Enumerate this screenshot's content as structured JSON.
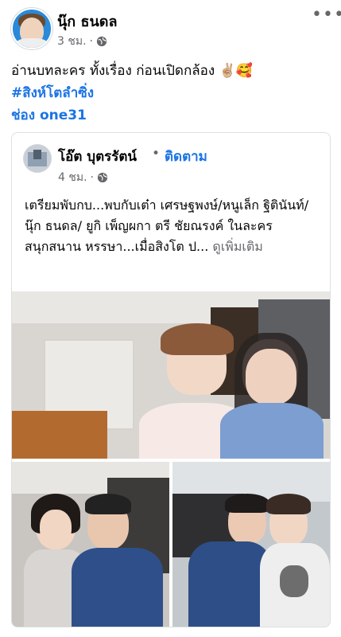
{
  "post": {
    "author": "นุ๊ก ธนดล",
    "time": "3 ชม.",
    "privacy_icon": "globe-icon",
    "more_icon": "more-options-icon",
    "caption": "อ่านบทละคร ทั้งเรื่อง ก่อนเปิดกล้อง ✌🏼🥰",
    "hashtag": "#สิงห์โตลำซิ่ง",
    "channel_tag": "ช่อง one31"
  },
  "shared": {
    "author": "โอ๊ต บุตรรัตน์",
    "dot": "•",
    "follow_label": "ติดตาม",
    "time": "4 ชม.",
    "privacy_icon": "globe-icon",
    "text": "เตรียมพับกบ...พบกับเต๋า เศรษฐพงษ์/หนูเล็ก ฐิตินันท์/นุ๊ก ธนดล/ ยูกิ เพ็ญผกา  ตรี ชัยณรงค์ ในละครสนุกสนาน หรรษา...เมื่อสิงโต ป...",
    "see_more": "ดูเพิ่มเติม"
  }
}
